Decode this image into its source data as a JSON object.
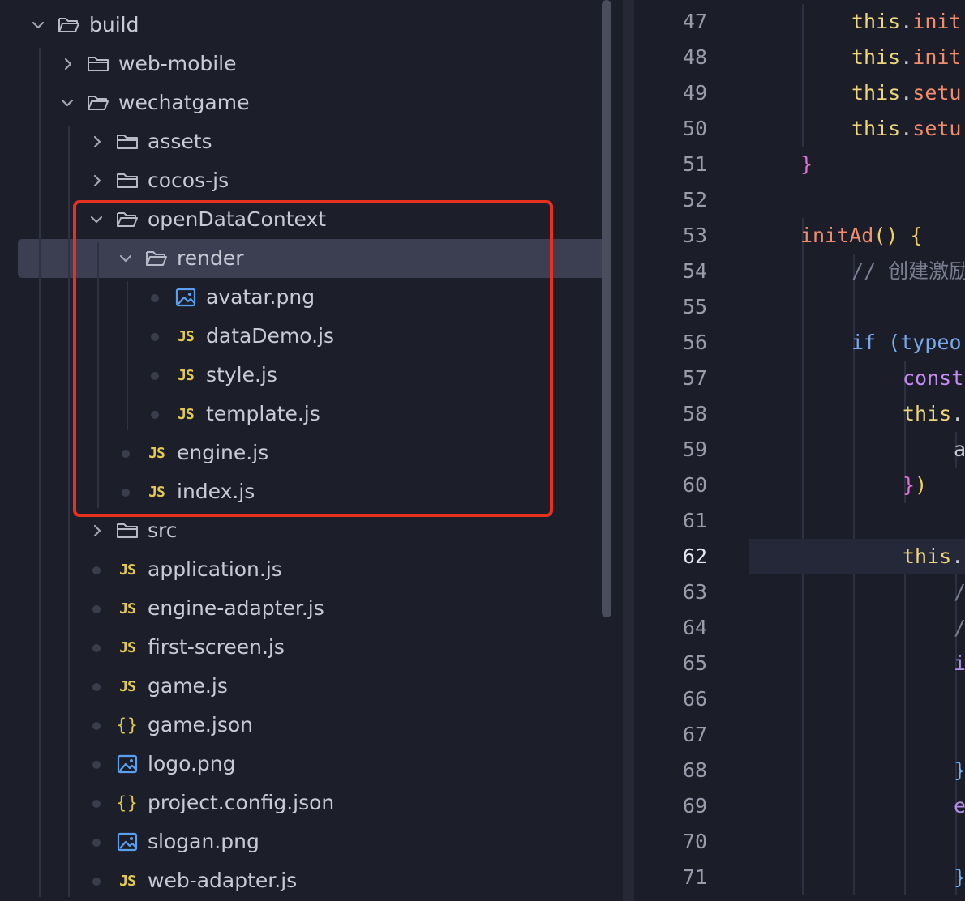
{
  "explorer": {
    "items": [
      {
        "label": "build",
        "kind": "folder",
        "depth": 0,
        "open": true
      },
      {
        "label": "web-mobile",
        "kind": "folder",
        "depth": 1,
        "open": false
      },
      {
        "label": "wechatgame",
        "kind": "folder",
        "depth": 1,
        "open": true
      },
      {
        "label": "assets",
        "kind": "folder",
        "depth": 2,
        "open": false
      },
      {
        "label": "cocos-js",
        "kind": "folder",
        "depth": 2,
        "open": false
      },
      {
        "label": "openDataContext",
        "kind": "folder",
        "depth": 2,
        "open": true
      },
      {
        "label": "render",
        "kind": "folder",
        "depth": 3,
        "open": true,
        "selected": true
      },
      {
        "label": "avatar.png",
        "kind": "image",
        "depth": 4
      },
      {
        "label": "dataDemo.js",
        "kind": "js",
        "depth": 4
      },
      {
        "label": "style.js",
        "kind": "js",
        "depth": 4
      },
      {
        "label": "template.js",
        "kind": "js",
        "depth": 4
      },
      {
        "label": "engine.js",
        "kind": "js",
        "depth": 3
      },
      {
        "label": "index.js",
        "kind": "js",
        "depth": 3
      },
      {
        "label": "src",
        "kind": "folder",
        "depth": 2,
        "open": false
      },
      {
        "label": "application.js",
        "kind": "js",
        "depth": 2
      },
      {
        "label": "engine-adapter.js",
        "kind": "js",
        "depth": 2
      },
      {
        "label": "first-screen.js",
        "kind": "js",
        "depth": 2
      },
      {
        "label": "game.js",
        "kind": "js",
        "depth": 2
      },
      {
        "label": "game.json",
        "kind": "json",
        "depth": 2
      },
      {
        "label": "logo.png",
        "kind": "image",
        "depth": 2
      },
      {
        "label": "project.config.json",
        "kind": "json",
        "depth": 2
      },
      {
        "label": "slogan.png",
        "kind": "image",
        "depth": 2
      },
      {
        "label": "web-adapter.js",
        "kind": "js",
        "depth": 2
      }
    ],
    "icon_text": {
      "js": "JS",
      "json": "{}"
    }
  },
  "editor": {
    "active_line": "62",
    "lines": [
      {
        "num": "47",
        "indent": 2,
        "tokens": [
          [
            "this",
            "this"
          ],
          [
            "punc",
            "."
          ],
          [
            "fn",
            "init"
          ]
        ]
      },
      {
        "num": "48",
        "indent": 2,
        "tokens": [
          [
            "this",
            "this"
          ],
          [
            "punc",
            "."
          ],
          [
            "fn",
            "init"
          ]
        ]
      },
      {
        "num": "49",
        "indent": 2,
        "tokens": [
          [
            "this",
            "this"
          ],
          [
            "punc",
            "."
          ],
          [
            "fn",
            "setu"
          ]
        ]
      },
      {
        "num": "50",
        "indent": 2,
        "tokens": [
          [
            "this",
            "this"
          ],
          [
            "punc",
            "."
          ],
          [
            "fn",
            "setu"
          ]
        ]
      },
      {
        "num": "51",
        "indent": 1,
        "tokens": [
          [
            "brace-pink",
            "}"
          ]
        ]
      },
      {
        "num": "52",
        "indent": 1,
        "tokens": []
      },
      {
        "num": "53",
        "indent": 1,
        "tokens": [
          [
            "fn",
            "initAd"
          ],
          [
            "brace-yel",
            "()"
          ],
          [
            "punc",
            " "
          ],
          [
            "brace-yel",
            "{"
          ]
        ]
      },
      {
        "num": "54",
        "indent": 2,
        "tokens": [
          [
            "comment",
            "// 创建激励"
          ]
        ]
      },
      {
        "num": "55",
        "indent": 2,
        "tokens": []
      },
      {
        "num": "56",
        "indent": 2,
        "tokens": [
          [
            "kw2",
            "if"
          ],
          [
            "punc",
            " "
          ],
          [
            "brace-blue",
            "("
          ],
          [
            "kw2",
            "typeo"
          ]
        ]
      },
      {
        "num": "57",
        "indent": 3,
        "tokens": [
          [
            "const",
            "const"
          ]
        ]
      },
      {
        "num": "58",
        "indent": 3,
        "tokens": [
          [
            "this",
            "this"
          ],
          [
            "punc",
            "."
          ]
        ]
      },
      {
        "num": "59",
        "indent": 4,
        "tokens": [
          [
            "var",
            "a"
          ]
        ]
      },
      {
        "num": "60",
        "indent": 3,
        "tokens": [
          [
            "brace-pink",
            "}"
          ],
          [
            "brace-yel",
            ")"
          ]
        ]
      },
      {
        "num": "61",
        "indent": 3,
        "tokens": []
      },
      {
        "num": "62",
        "indent": 3,
        "tokens": [
          [
            "this",
            "this"
          ],
          [
            "punc",
            "."
          ]
        ]
      },
      {
        "num": "63",
        "indent": 4,
        "tokens": [
          [
            "comment",
            "/"
          ]
        ]
      },
      {
        "num": "64",
        "indent": 4,
        "tokens": [
          [
            "comment",
            "/"
          ]
        ]
      },
      {
        "num": "65",
        "indent": 4,
        "tokens": [
          [
            "kw",
            "i"
          ]
        ]
      },
      {
        "num": "66",
        "indent": 4,
        "tokens": []
      },
      {
        "num": "67",
        "indent": 4,
        "tokens": []
      },
      {
        "num": "68",
        "indent": 4,
        "tokens": [
          [
            "brace-blue",
            "}"
          ]
        ]
      },
      {
        "num": "69",
        "indent": 4,
        "tokens": [
          [
            "kw",
            "e"
          ]
        ]
      },
      {
        "num": "70",
        "indent": 4,
        "tokens": []
      },
      {
        "num": "71",
        "indent": 4,
        "tokens": [
          [
            "brace-blue",
            "}"
          ]
        ]
      }
    ]
  },
  "colors": {
    "highlight_box": "#e8301f",
    "selection": "#3b3f51",
    "js_icon": "#e3c94f",
    "image_icon": "#5aa0f0"
  }
}
